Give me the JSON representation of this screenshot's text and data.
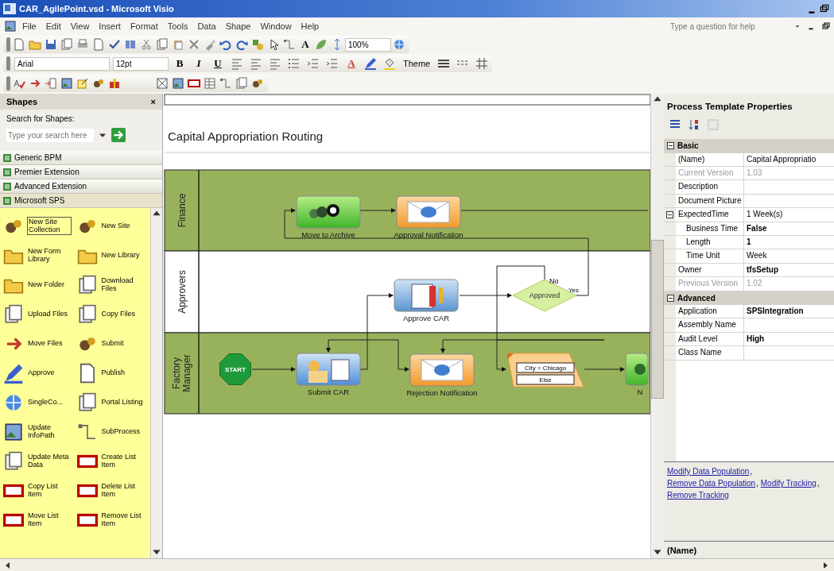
{
  "window": {
    "title": "CAR_AgilePoint.vsd - Microsoft Visio"
  },
  "menu": [
    {
      "label": "File"
    },
    {
      "label": "Edit"
    },
    {
      "label": "View"
    },
    {
      "label": "Insert"
    },
    {
      "label": "Format"
    },
    {
      "label": "Tools"
    },
    {
      "label": "Data"
    },
    {
      "label": "Shape"
    },
    {
      "label": "Window"
    },
    {
      "label": "Help"
    }
  ],
  "help_search": {
    "placeholder": "Type a question for help"
  },
  "toolbars": {
    "text_tool": "A",
    "zoom": "100%",
    "font": "Arial",
    "font_size": "12pt",
    "format_buttons": [
      "B",
      "I",
      "U"
    ],
    "font_color": "A",
    "theme": "Theme"
  },
  "shapes_panel": {
    "title": "Shapes",
    "close": "×",
    "search_label": "Search for Shapes:",
    "search_placeholder": "Type your search here",
    "stencils": [
      {
        "name": "Generic BPM",
        "selected": false
      },
      {
        "name": "Premier Extension",
        "selected": false
      },
      {
        "name": "Advanced Extension",
        "selected": false
      },
      {
        "name": "Microsoft SPS",
        "selected": true
      }
    ],
    "items": [
      {
        "label": "New Site Collection",
        "selected": true
      },
      {
        "label": "New Site",
        "selected": false
      },
      {
        "label": "New Form Library",
        "selected": false
      },
      {
        "label": "New Library",
        "selected": false
      },
      {
        "label": "New Folder",
        "selected": false
      },
      {
        "label": "Download Files",
        "selected": false
      },
      {
        "label": "Upload Files",
        "selected": false
      },
      {
        "label": "Copy Files",
        "selected": false
      },
      {
        "label": "Move Files",
        "selected": false
      },
      {
        "label": "Submit",
        "selected": false
      },
      {
        "label": "Approve",
        "selected": false
      },
      {
        "label": "Publish",
        "selected": false
      },
      {
        "label": "SingleCo...",
        "selected": false
      },
      {
        "label": "Portal Listing",
        "selected": false
      },
      {
        "label": "Update InfoPath",
        "selected": false
      },
      {
        "label": "SubProcess",
        "selected": false
      },
      {
        "label": "Update Meta Data",
        "selected": false
      },
      {
        "label": "Create List Item",
        "selected": false
      },
      {
        "label": "Copy List Item",
        "selected": false
      },
      {
        "label": "Delete List Item",
        "selected": false
      },
      {
        "label": "Move List Item",
        "selected": false
      },
      {
        "label": "Remove List Item",
        "selected": false
      }
    ]
  },
  "diagram": {
    "title": "Capital Appropriation Routing",
    "lanes": [
      {
        "name": "Finance"
      },
      {
        "name": "Approvers"
      },
      {
        "name": "Factory Manager"
      }
    ],
    "nodes": [
      {
        "kind": "archive",
        "label": "Move to Archive"
      },
      {
        "kind": "email",
        "label": "Approval Notification"
      },
      {
        "kind": "approval",
        "label": "Approve CAR"
      },
      {
        "kind": "decision",
        "label": "Approved",
        "outcomes": [
          "No",
          "Yes"
        ]
      },
      {
        "kind": "start",
        "label": "START"
      },
      {
        "kind": "submit",
        "label": "Submit CAR"
      },
      {
        "kind": "email",
        "label": "Rejection Notification"
      },
      {
        "kind": "condition",
        "rules": [
          "City = Chicago",
          "Else"
        ]
      },
      {
        "kind": "task",
        "label": "N"
      }
    ]
  },
  "properties": {
    "title": "Process Template Properties",
    "categories": [
      {
        "name": "Basic",
        "expanded": true,
        "rows": [
          {
            "name": "(Name)",
            "value": "Capital Appropriatio",
            "readonly": false,
            "modified": false
          },
          {
            "name": "Current Version",
            "value": "1.03",
            "readonly": true,
            "modified": false
          },
          {
            "name": "Description",
            "readonly": false,
            "modified": false
          },
          {
            "name": "Document Picture",
            "readonly": false,
            "modified": false
          },
          {
            "name": "ExpectedTime",
            "value": "1 Week(s)",
            "readonly": false,
            "modified": false,
            "expanded": true,
            "children": [
              {
                "name": "Business Time",
                "value": "False",
                "readonly": false,
                "modified": true
              },
              {
                "name": "Length",
                "value": "1",
                "readonly": false,
                "modified": true
              },
              {
                "name": "Time Unit",
                "value": "Week",
                "readonly": false,
                "modified": false
              }
            ]
          },
          {
            "name": "Owner",
            "value": "tfsSetup",
            "readonly": false,
            "modified": true
          },
          {
            "name": "Previous Version",
            "value": "1.02",
            "readonly": true,
            "modified": false
          }
        ]
      },
      {
        "name": "Advanced",
        "expanded": true,
        "rows": [
          {
            "name": "Application",
            "value": "SPSIntegration",
            "readonly": false,
            "modified": true
          },
          {
            "name": "Assembly Name",
            "readonly": false,
            "modified": false
          },
          {
            "name": "Audit Level",
            "value": "High",
            "readonly": false,
            "modified": true
          },
          {
            "name": "Class Name",
            "readonly": false,
            "modified": false
          }
        ]
      }
    ],
    "commands": [
      {
        "label": "Modify Data Population"
      },
      {
        "label": "Remove Data Population"
      },
      {
        "label": "Modify Tracking"
      },
      {
        "label": "Remove Tracking"
      }
    ],
    "separator": ", ",
    "description": "(Name)"
  }
}
